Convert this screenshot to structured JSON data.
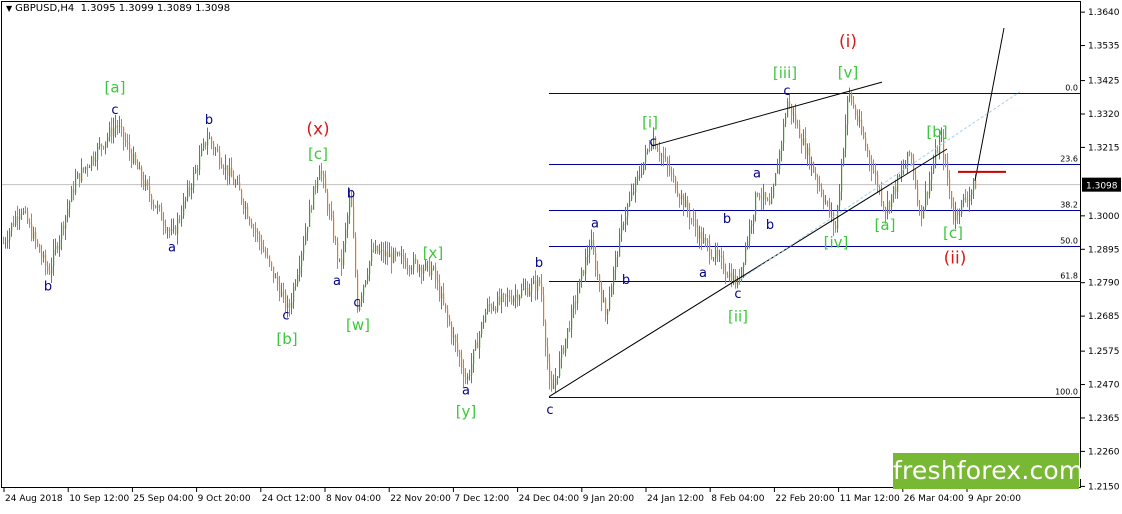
{
  "header": {
    "symbol": "GBPUSD,H4",
    "ohlc": "1.3095 1.3099 1.3089 1.3098"
  },
  "logo_text": "freshforex.com",
  "colors": {
    "candle_up": "#3c9c1c",
    "candle_down": "#e8771c",
    "fib": "#0000a0",
    "wave_green": "#3cc83c",
    "wave_red": "#d81a1a",
    "wave_blue": "#00008b",
    "current_price_bg": "#000000"
  },
  "chart_data": {
    "type": "candlestick",
    "symbol": "GBPUSD",
    "timeframe": "H4",
    "ylim": [
      1.2145,
      1.3675
    ],
    "y_ticks": [
      "1.3640",
      "1.3535",
      "1.3425",
      "1.3320",
      "1.3215",
      "1.3098",
      "1.3000",
      "1.2895",
      "1.2790",
      "1.2685",
      "1.2575",
      "1.2470",
      "1.2365",
      "1.2260",
      "1.2150"
    ],
    "current_price": "1.3098",
    "x_labels": [
      "24 Aug 2018",
      "10 Sep 12:00",
      "25 Sep 04:00",
      "9 Oct 20:00",
      "24 Oct 12:00",
      "8 Nov 04:00",
      "22 Nov 20:00",
      "7 Dec 12:00",
      "24 Dec 04:00",
      "9 Jan 20:00",
      "24 Jan 12:00",
      "8 Feb 04:00",
      "22 Feb 20:00",
      "11 Mar 12:00",
      "26 Mar 04:00",
      "9 Apr 20:00"
    ],
    "price_path": [
      [
        0,
        1.2895
      ],
      [
        20,
        1.303
      ],
      [
        48,
        1.282
      ],
      [
        75,
        1.311
      ],
      [
        116,
        1.329
      ],
      [
        145,
        1.309
      ],
      [
        172,
        1.2935
      ],
      [
        207,
        1.325
      ],
      [
        238,
        1.308
      ],
      [
        288,
        1.27
      ],
      [
        319,
        1.316
      ],
      [
        340,
        1.283
      ],
      [
        350,
        1.307
      ],
      [
        357,
        1.272
      ],
      [
        372,
        1.289
      ],
      [
        432,
        1.283
      ],
      [
        466,
        1.248
      ],
      [
        486,
        1.271
      ],
      [
        540,
        1.279
      ],
      [
        550,
        1.243
      ],
      [
        590,
        1.292
      ],
      [
        605,
        1.269
      ],
      [
        623,
        1.299
      ],
      [
        652,
        1.325
      ],
      [
        700,
        1.293
      ],
      [
        737,
        1.2785
      ],
      [
        757,
        1.308
      ],
      [
        770,
        1.302
      ],
      [
        787,
        1.336
      ],
      [
        810,
        1.317
      ],
      [
        835,
        1.296
      ],
      [
        848,
        1.339
      ],
      [
        885,
        1.302
      ],
      [
        910,
        1.32
      ],
      [
        920,
        1.3
      ],
      [
        940,
        1.325
      ],
      [
        953,
        1.3
      ],
      [
        975,
        1.31
      ]
    ],
    "fibonacci": {
      "levels": [
        {
          "label": "0.0",
          "price": 1.3385
        },
        {
          "label": "23.6",
          "price": 1.3162
        },
        {
          "label": "38.2",
          "price": 1.3018
        },
        {
          "label": "50.0",
          "price": 1.2906
        },
        {
          "label": "61.8",
          "price": 1.2795
        },
        {
          "label": "100.0",
          "price": 1.2432
        }
      ]
    },
    "annotations": [
      {
        "text": "[a]",
        "color": "green",
        "x": 115,
        "y": 1.3387
      },
      {
        "text": "c",
        "color": "blue",
        "x": 115,
        "y": 1.332
      },
      {
        "text": "b",
        "color": "blue",
        "x": 48,
        "y": 1.2765
      },
      {
        "text": "b",
        "color": "blue",
        "x": 209,
        "y": 1.3288
      },
      {
        "text": "a",
        "color": "blue",
        "x": 172,
        "y": 1.2888
      },
      {
        "text": "(x)",
        "color": "red",
        "x": 318,
        "y": 1.3255
      },
      {
        "text": "[c]",
        "color": "green",
        "x": 318,
        "y": 1.3178
      },
      {
        "text": "c",
        "color": "blue",
        "x": 286,
        "y": 1.2675
      },
      {
        "text": "[b]",
        "color": "green",
        "x": 287,
        "y": 1.2598
      },
      {
        "text": "b",
        "color": "blue",
        "x": 351,
        "y": 1.3058
      },
      {
        "text": "a",
        "color": "blue",
        "x": 337,
        "y": 1.2782
      },
      {
        "text": "c",
        "color": "blue",
        "x": 357,
        "y": 1.2715
      },
      {
        "text": "[w]",
        "color": "green",
        "x": 358,
        "y": 1.2642
      },
      {
        "text": "[x]",
        "color": "green",
        "x": 433,
        "y": 1.2868
      },
      {
        "text": "a",
        "color": "blue",
        "x": 466,
        "y": 1.2438
      },
      {
        "text": "[y]",
        "color": "green",
        "x": 466,
        "y": 1.237
      },
      {
        "text": "b",
        "color": "blue",
        "x": 539,
        "y": 1.284
      },
      {
        "text": "c",
        "color": "blue",
        "x": 550,
        "y": 1.2378
      },
      {
        "text": "a",
        "color": "blue",
        "x": 595,
        "y": 1.2963
      },
      {
        "text": "b",
        "color": "blue",
        "x": 626,
        "y": 1.2786
      },
      {
        "text": "[i]",
        "color": "green",
        "x": 650,
        "y": 1.3278
      },
      {
        "text": "c",
        "color": "blue",
        "x": 653,
        "y": 1.322
      },
      {
        "text": "b",
        "color": "blue",
        "x": 727,
        "y": 1.2978
      },
      {
        "text": "a",
        "color": "blue",
        "x": 703,
        "y": 1.2808
      },
      {
        "text": "c",
        "color": "blue",
        "x": 738,
        "y": 1.2742
      },
      {
        "text": "[ii]",
        "color": "green",
        "x": 738,
        "y": 1.2668
      },
      {
        "text": "a",
        "color": "blue",
        "x": 757,
        "y": 1.312
      },
      {
        "text": "b",
        "color": "blue",
        "x": 770,
        "y": 1.2958
      },
      {
        "text": "[iii]",
        "color": "green",
        "x": 785,
        "y": 1.3433
      },
      {
        "text": "c",
        "color": "blue",
        "x": 787,
        "y": 1.338
      },
      {
        "text": "(i)",
        "color": "red",
        "x": 848,
        "y": 1.353
      },
      {
        "text": "[v]",
        "color": "green",
        "x": 848,
        "y": 1.3435
      },
      {
        "text": "[iv]",
        "color": "green",
        "x": 836,
        "y": 1.29
      },
      {
        "text": "[a]",
        "color": "green",
        "x": 885,
        "y": 1.2955
      },
      {
        "text": "[b]",
        "color": "green",
        "x": 937,
        "y": 1.3248
      },
      {
        "text": "[c]",
        "color": "green",
        "x": 953,
        "y": 1.293
      },
      {
        "text": "(ii)",
        "color": "red",
        "x": 955,
        "y": 1.285
      }
    ]
  }
}
